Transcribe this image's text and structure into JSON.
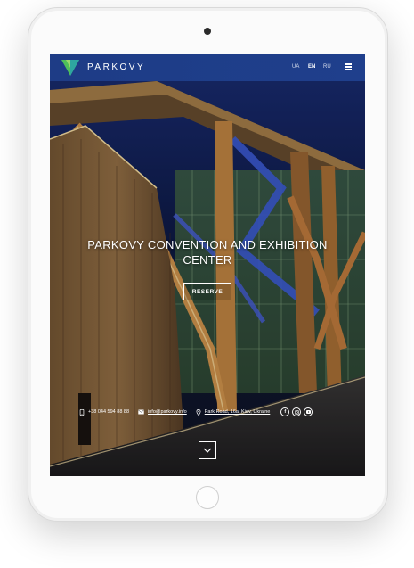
{
  "header": {
    "logo_text": "PARKOVY",
    "languages": [
      {
        "label": "UA",
        "active": false
      },
      {
        "label": "EN",
        "active": true
      },
      {
        "label": "RU",
        "active": false
      }
    ],
    "menu_icon": "hamburger-menu-icon"
  },
  "hero": {
    "title_line1": "PARKOVY CONVENTION AND EXHIBITION",
    "title_line2": "CENTER",
    "reserve_label": "RESERVE"
  },
  "contacts": {
    "phone": "+38 044 594 88 88",
    "email": "info@parkovy.info",
    "address": "Park Road, 16a, Kiev, Ukraine",
    "social": [
      "facebook-icon",
      "instagram-icon",
      "youtube-icon"
    ]
  },
  "scroll_down_icon": "chevron-down-icon",
  "colors": {
    "header_blue": "#1f3f8c",
    "logo_green": "#4fbf5a",
    "logo_teal": "#2ea7a0",
    "accent_blue_light": "#3a5fd0",
    "warm_light": "#e8a63a"
  }
}
